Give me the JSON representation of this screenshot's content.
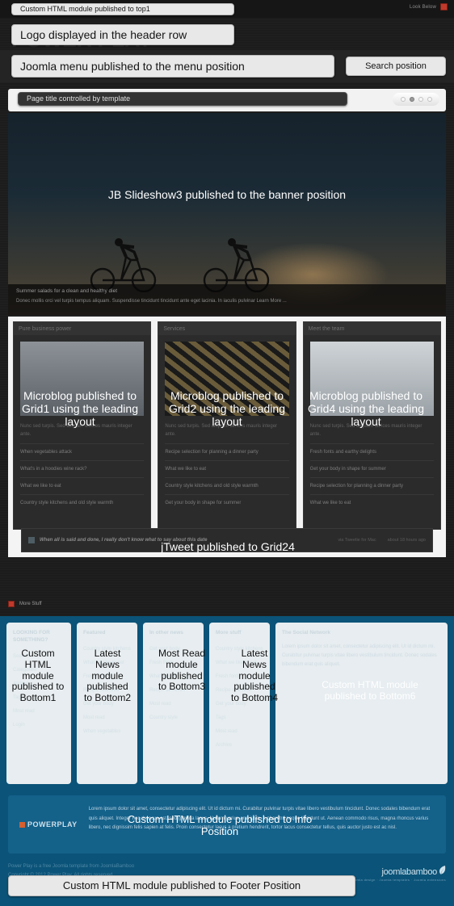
{
  "topbar": {
    "right_text": "Look Below",
    "right_icon": "red-square-icon"
  },
  "ghost_logo": "POWER PLAY",
  "overlays": {
    "top1": "Custom HTML module published to top1",
    "logo": "Logo displayed in the header row",
    "menu": "Joomla menu published to the menu position",
    "search": "Search position",
    "page_title": "Page title controlled by template",
    "banner": "JB Slideshow3 published to the banner position",
    "grid1": "Microblog published to Grid1 using the leading layout",
    "grid2": "Microblog published to Grid2 using the leading layout",
    "grid4": "Microblog published to Grid4 using the leading layout",
    "grid24": "jTweet published to Grid24",
    "bottom1": "Custom HTML module published to Bottom1",
    "bottom2": "Latest News module published to Bottom2",
    "bottom3": "Most Read module published to Bottom3",
    "bottom4": "Latest News module published to Bottom4",
    "bottom6": "Custom HTML module published to Bottom6",
    "info": "Custom HTML module published to Info Position",
    "footer": "Custom HTML module published to Footer Position"
  },
  "slideshow": {
    "pager_dots": 4,
    "active_dot_index": 1,
    "caption_title": "Summer salads for a clean and healthy diet",
    "caption_text": "Donec mollis orci vel turpis tempus aliquam. Suspendisse tincidunt tincidunt ante eget lacinia. In iaculis pulvinar Learn More ..."
  },
  "grid_columns": [
    {
      "heading": "Pure business power",
      "intro": "Nunc sed turpis. Sed aliquam ultrices mauris integer ante.",
      "items": [
        "When vegetables attack",
        "What's in a hoodies wine rack?",
        "What we like to eat",
        "Country style kitchens and old style warmth"
      ]
    },
    {
      "heading": "Services",
      "intro": "Nunc sed turpis. Sed aliquam ultrices mauris integer ante.",
      "items": [
        "Recipe selection for planning a dinner party",
        "What we like to eat",
        "Country style kitchens and old style warmth",
        "Get your body in shape for summer"
      ]
    },
    {
      "heading": "Meet the team",
      "intro": "Nunc sed turpis. Sed aliquam ultrices mauris integer ante.",
      "items": [
        "Fresh fonts and earthy delights",
        "Get your body in shape for summer",
        "Recipe selection for planning a dinner party",
        "What we like to eat"
      ]
    }
  ],
  "tweet": {
    "text": "When all is said and done, I really don't know what to say about this date",
    "meta_1": "via Tweetie for Mac",
    "meta_2": "about 18 hours ago"
  },
  "more_stuff": {
    "label": "More Stuff",
    "icon": "red-square-icon"
  },
  "bottom_columns": [
    {
      "heading": "LOOKING FOR SOMETHING?",
      "items": [
        "Search",
        "Categories",
        "Archive",
        "Tags",
        "Most read",
        "Login"
      ]
    },
    {
      "heading": "Featured",
      "items": [
        "Country style kitchens",
        "What we like to eat",
        "Fresh fonts",
        "Recipe selection",
        "Get your body",
        "Most read",
        "When vegetables"
      ]
    },
    {
      "heading": "In other news",
      "items": [
        "Get your body",
        "Fresh fonts",
        "What we like",
        "Recipe selection",
        "Most read",
        "Country style"
      ]
    },
    {
      "heading": "More stuff",
      "items": [
        "Country style kitchens",
        "What we like to eat",
        "Fresh fonts",
        "Recipe selection",
        "Get your body",
        "Tags",
        "Most read",
        "Archive",
        "Country style"
      ]
    },
    {
      "heading": "The Social Network",
      "paragraph": "Lorem ipsum dolor sit amet, consectetur adipiscing elit. Ut id dictum mi. Curabitur pulvinar turpis vitae libero vestibulum tincidunt. Donec sodales bibendum erat quis aliquet."
    }
  ],
  "info": {
    "logo": "POWERPLAY",
    "text": "Lorem ipsum dolor sit amet, consectetur adipiscing elit. Ut id dictum mi. Curabitur pulvinar turpis vitae libero vestibulum tincidunt. Donec sodales bibendum erat quis aliquet. Integer nec rhoncus est, sed gravida lacus. Nullam varius erat justo, a pharetra neque tincidunt ut. Aenean commodo risus, magna rhoncus varius libero, nec dignissim felis sapien at felis. Proin consectetur lacus a pretium hendrerit, tortor lacus consectetur tellus, quis auctor justo est ac nisl."
  },
  "footer": {
    "line_1": "Power Play is a free Joomla template from JoomlaBamboo",
    "line_2": "Copyright © 2012 Power Play. All rights reserved.",
    "brand_name": "joomlabamboo",
    "brand_sub": "Joomla design · Joomla templates · Joomla extensions",
    "brand_icon": "leaf-icon"
  },
  "colors": {
    "dark_bg": "#1c1c1c",
    "blue_bg": "#0b5378",
    "info_bg": "#14618a",
    "label_bg": "#e8e8e8",
    "accent_red": "#c0392b"
  }
}
